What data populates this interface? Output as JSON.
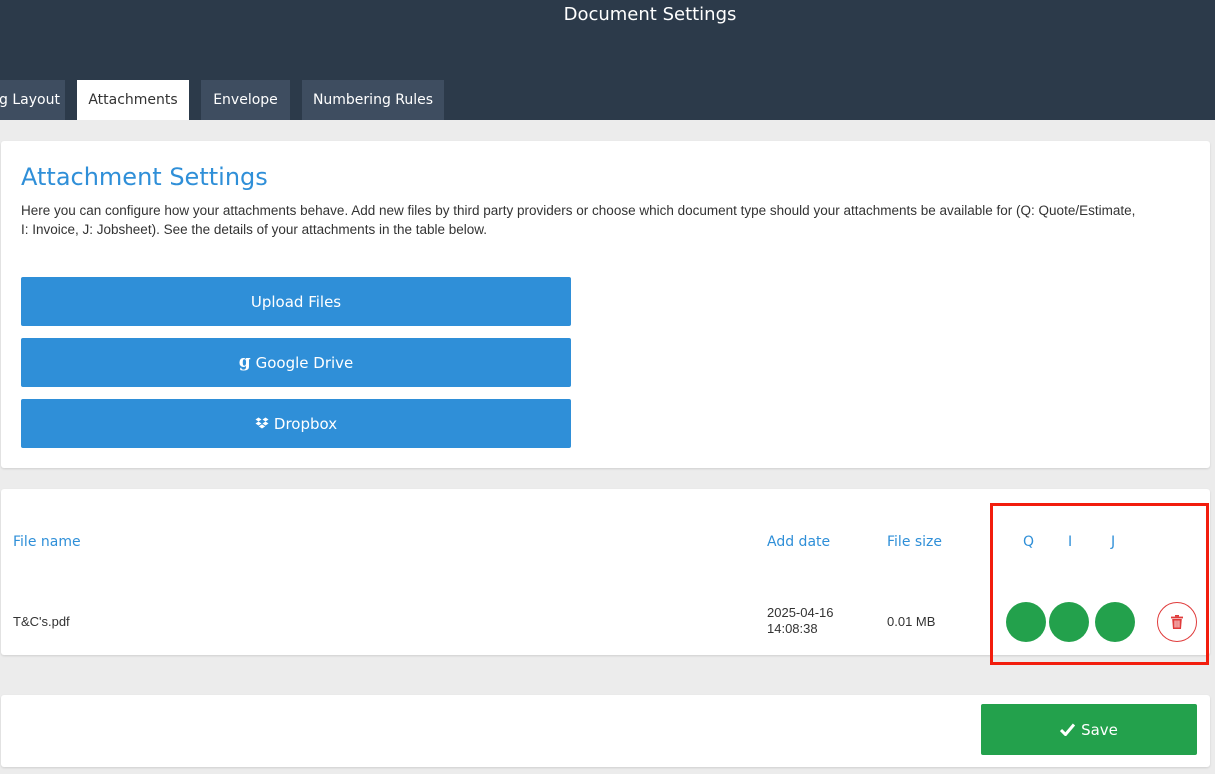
{
  "header": {
    "title": "Document Settings"
  },
  "tabs": [
    {
      "label": "g Layout",
      "active": false
    },
    {
      "label": "Attachments",
      "active": true
    },
    {
      "label": "Envelope",
      "active": false
    },
    {
      "label": "Numbering Rules",
      "active": false
    }
  ],
  "settings": {
    "title": "Attachment Settings",
    "description": "Here you can configure how your attachments behave. Add new files by third party providers or choose which document type should your attachments be available for (Q: Quote/Estimate, I: Invoice, J: Jobsheet). See the details of your attachments in the table below.",
    "buttons": {
      "upload": "Upload Files",
      "google_drive": "Google Drive",
      "google_drive_icon": "g",
      "dropbox": "Dropbox"
    }
  },
  "table": {
    "headers": {
      "file_name": "File name",
      "add_date": "Add date",
      "file_size": "File size",
      "q": "Q",
      "i": "I",
      "j": "J"
    },
    "rows": [
      {
        "file_name": "T&C's.pdf",
        "add_date_line1": "2025-04-16",
        "add_date_line2": "14:08:38",
        "file_size": "0.01 MB",
        "q_enabled": true,
        "i_enabled": true,
        "j_enabled": true
      }
    ]
  },
  "footer": {
    "save_label": "Save"
  },
  "colors": {
    "header_bg": "#2c3a4a",
    "tab_bg": "#3e4d60",
    "accent_blue": "#2f8fd8",
    "toggle_green": "#23a14c",
    "delete_red": "#e03b3b",
    "highlight_red": "#f21d0d"
  },
  "icons": {
    "google_drive": "google-g-icon",
    "dropbox": "dropbox-icon",
    "delete": "trash-icon",
    "save": "checkmark-icon"
  }
}
